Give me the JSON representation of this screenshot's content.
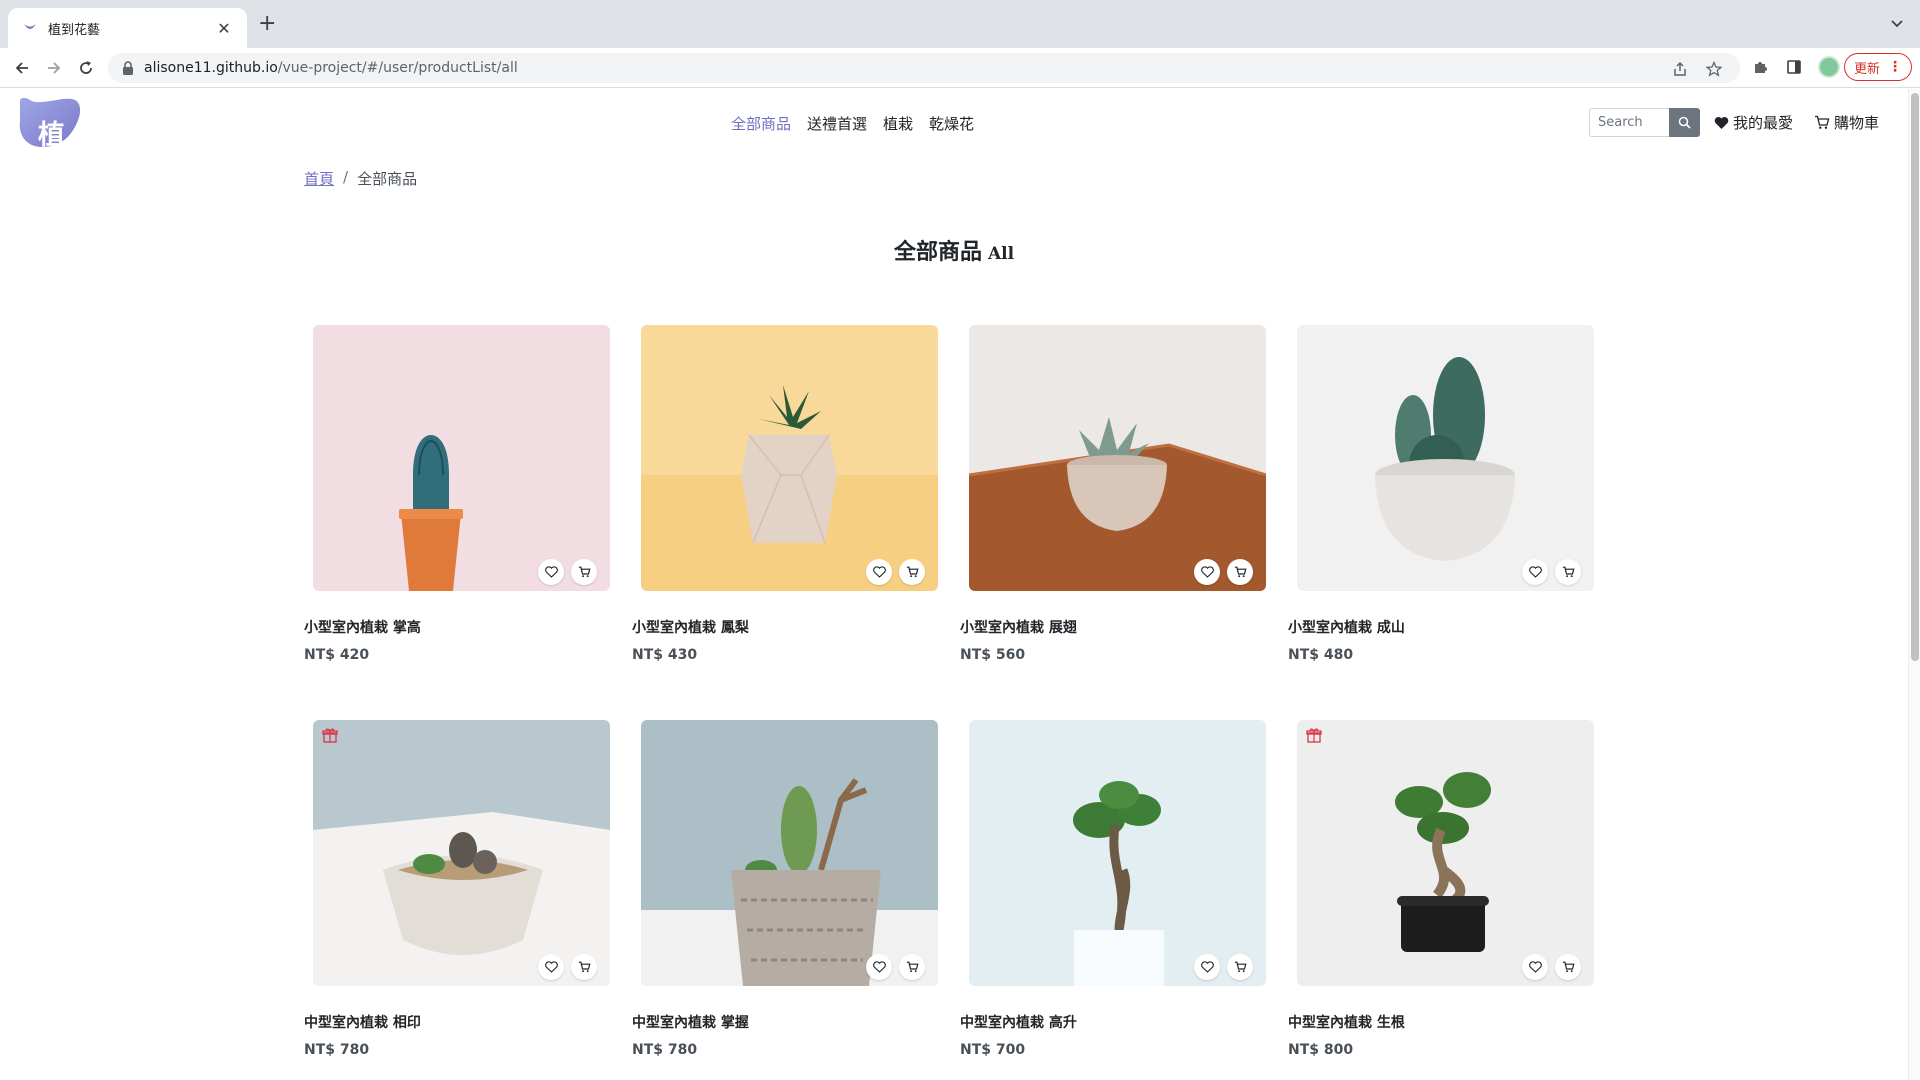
{
  "browser": {
    "tab_title": "植到花藝",
    "url_host": "alisone11.github.io",
    "url_path": "/vue-project/#/user/productList/all",
    "update_label": "更新"
  },
  "nav": {
    "logo_text": "植到",
    "menu": [
      "全部商品",
      "送禮首選",
      "植栽",
      "乾燥花"
    ],
    "active_index": 0,
    "search_placeholder": "Search",
    "favorites_label": "我的最愛",
    "cart_label": "購物車"
  },
  "breadcrumb": {
    "home": "首頁",
    "separator": "/",
    "current": "全部商品"
  },
  "heading": {
    "zh": "全部商品",
    "en": "All"
  },
  "products": [
    {
      "name": "小型室內植栽 掌高",
      "price": "NT$ 420",
      "gift": false,
      "photo_bg": "#f2dde2"
    },
    {
      "name": "小型室內植栽 鳳梨",
      "price": "NT$ 430",
      "gift": false,
      "photo_bg": "#f9d99a"
    },
    {
      "name": "小型室內植栽 展翅",
      "price": "NT$ 560",
      "gift": false,
      "photo_bg": "#e8e4e1"
    },
    {
      "name": "小型室內植栽 成山",
      "price": "NT$ 480",
      "gift": false,
      "photo_bg": "#f1f1f1"
    },
    {
      "name": "中型室內植栽 相印",
      "price": "NT$ 780",
      "gift": true,
      "photo_bg": "#b9c8cf"
    },
    {
      "name": "中型室內植栽 掌握",
      "price": "NT$ 780",
      "gift": false,
      "photo_bg": "#adbfc6"
    },
    {
      "name": "中型室內植栽 高升",
      "price": "NT$ 700",
      "gift": false,
      "photo_bg": "#e3eef2"
    },
    {
      "name": "中型室內植栽 生根",
      "price": "NT$ 800",
      "gift": true,
      "photo_bg": "#eeeeee"
    }
  ],
  "colors": {
    "accent": "#6f6fc4",
    "gift_red": "#dc3545",
    "search_btn": "#6c757d"
  }
}
